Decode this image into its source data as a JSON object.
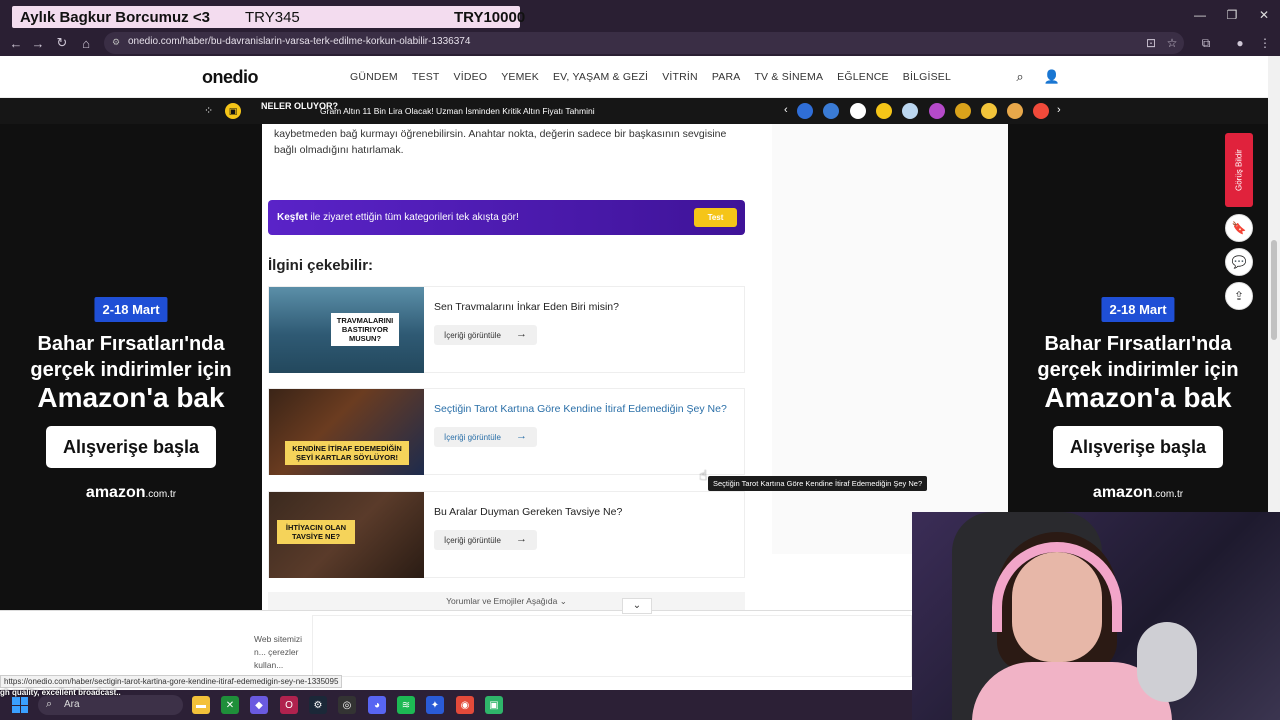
{
  "overlay": {
    "left": "Aylık Bagkur Borcumuz <3",
    "mid": "TRY345",
    "right": "TRY10000"
  },
  "browser": {
    "url": "onedio.com/haber/bu-davranislarin-varsa-terk-edilme-korkun-olabilir-1336374"
  },
  "site": {
    "logo": "onedio",
    "nav": [
      "GÜNDEM",
      "TEST",
      "VİDEO",
      "YEMEK",
      "EV, YAŞAM & GEZİ",
      "VİTRİN",
      "PARA",
      "TV & SİNEMA",
      "EĞLENCE",
      "BİLGİSEL"
    ]
  },
  "ticker": {
    "label": "NELER OLUYOR?",
    "headline": "Gram Altın 11 Bin Lira Olacak! Uzman İsminden Kritik Altın Fiyatı Tahmini"
  },
  "article": {
    "paragraph": "kaybetmeden bağ kurmayı öğrenebilirsin. Anahtar nokta, değerin sadece bir başkasının sevgisine bağlı olmadığını hatırlamak.",
    "kesfet_bold": "Keşfet",
    "kesfet_rest": " ile ziyaret ettiğin tüm kategorileri tek akışta gör!",
    "kesfet_btn": "Test",
    "related_title": "İlgini çekebilir:",
    "cards": [
      {
        "title": "Sen Travmalarını İnkar Eden Biri misin?",
        "button": "İçeriği görüntüle",
        "img_label": "TRAVMALARINI BASTIRIYOR MUSUN?"
      },
      {
        "title": "Seçtiğin Tarot Kartına Göre Kendine İtiraf Edemediğin Şey Ne?",
        "button": "İçeriği görüntüle",
        "img_label": "KENDİNE İTİRAF EDEMEDİĞİN ŞEYİ KARTLAR SÖYLÜYOR!"
      },
      {
        "title": "Bu Aralar Duyman Gereken Tavsiye Ne?",
        "button": "İçeriği görüntüle",
        "img_label": "İHTİYACIN OLAN TAVSİYE NE?"
      }
    ],
    "comments_link": "Yorumlar ve Emojiler Aşağıda"
  },
  "ad": {
    "date": "2-18 Mart",
    "line1": "Bahar Fırsatları'nda",
    "line2": "gerçek indirimler için",
    "line3": "Amazon'a bak",
    "cta": "Alışverişe başla",
    "brand": "amazon",
    "brand_suffix": ".com.tr"
  },
  "side_tools": {
    "feedback": "Görüş Bildir"
  },
  "tooltip": "Seçtiğin Tarot Kartına Göre Kendine İtiraf Edemediğin Şey Ne?",
  "cookie": {
    "text": "Web sitemizi n... çerezler kullan..."
  },
  "status": {
    "url": "https://onedio.com/haber/sectigin-tarot-kartina-gore-kendine-itiraf-edemedigin-sey-ne-1335095"
  },
  "chat": {
    "line": "gh quality, excellent broadcast.."
  },
  "taskbar": {
    "search_placeholder": "Ara"
  },
  "colors": {
    "accent_purple": "#5a23c8",
    "ad_blue": "#1f4fd6",
    "feedback_red": "#e0223c",
    "link_blue": "#2a6fa8"
  }
}
